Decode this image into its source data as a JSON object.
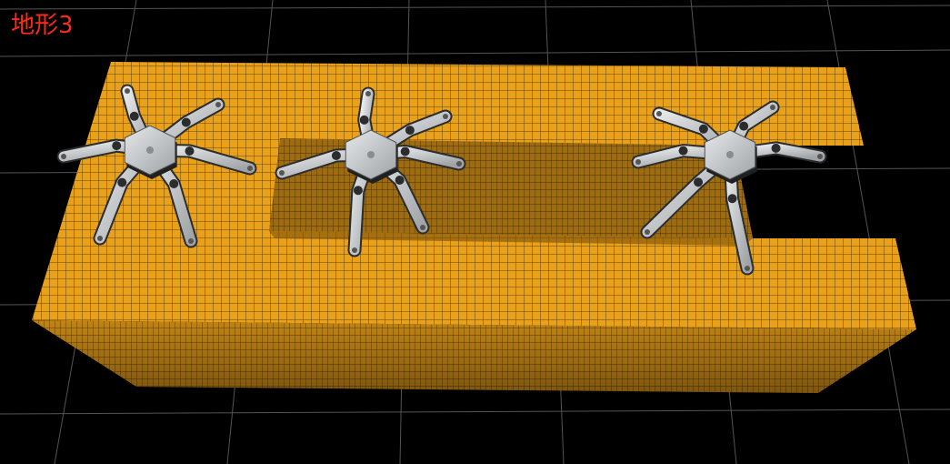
{
  "caption": "地形3",
  "colors": {
    "background": "#000000",
    "floor_grid": "#6a6a6a",
    "terrain_top": "#e9a11c",
    "terrain_side": "#b5780f",
    "terrain_grid": "#3a2a05",
    "caption": "#ff2a1a",
    "robot_body": "#c9ccce",
    "robot_joint": "#2a2c2e"
  },
  "robots": [
    {
      "name": "hexapod-robot-1"
    },
    {
      "name": "hexapod-robot-2"
    },
    {
      "name": "hexapod-robot-3"
    }
  ]
}
